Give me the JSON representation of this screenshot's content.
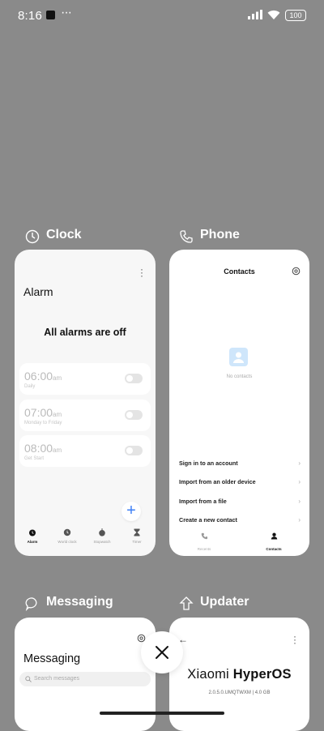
{
  "status": {
    "time": "8:16",
    "dots": "···",
    "battery": "100"
  },
  "apps": {
    "clock": {
      "name": "Clock",
      "title": "Alarm",
      "empty_text": "All alarms are off",
      "alarms": [
        {
          "time": "06:00",
          "suffix": "am",
          "days": "Daily"
        },
        {
          "time": "07:00",
          "suffix": "am",
          "days": "Monday to Friday"
        },
        {
          "time": "08:00",
          "suffix": "am",
          "days": "Get Start"
        }
      ],
      "tabs": [
        "Alarm",
        "World clock",
        "Stopwatch",
        "Timer"
      ],
      "active_tab": "Alarm",
      "fab_label": "+"
    },
    "phone": {
      "name": "Phone",
      "title": "Contacts",
      "empty_text": "No contacts",
      "options": [
        "Sign in to an account",
        "Import from an older device",
        "Import from a file",
        "Create a new contact"
      ],
      "tabs": [
        "Recents",
        "Contacts"
      ],
      "active_tab": "Contacts"
    },
    "messaging": {
      "name": "Messaging",
      "title": "Messaging",
      "search_placeholder": "Search messages"
    },
    "updater": {
      "name": "Updater",
      "brand_light": "Xiaomi ",
      "brand_bold": "HyperOS",
      "version": "2.0.5.0.UMQTWXM | 4.0 GB"
    }
  },
  "colors": {
    "background": "#8a8a8a",
    "accent": "#3d7ff5"
  }
}
